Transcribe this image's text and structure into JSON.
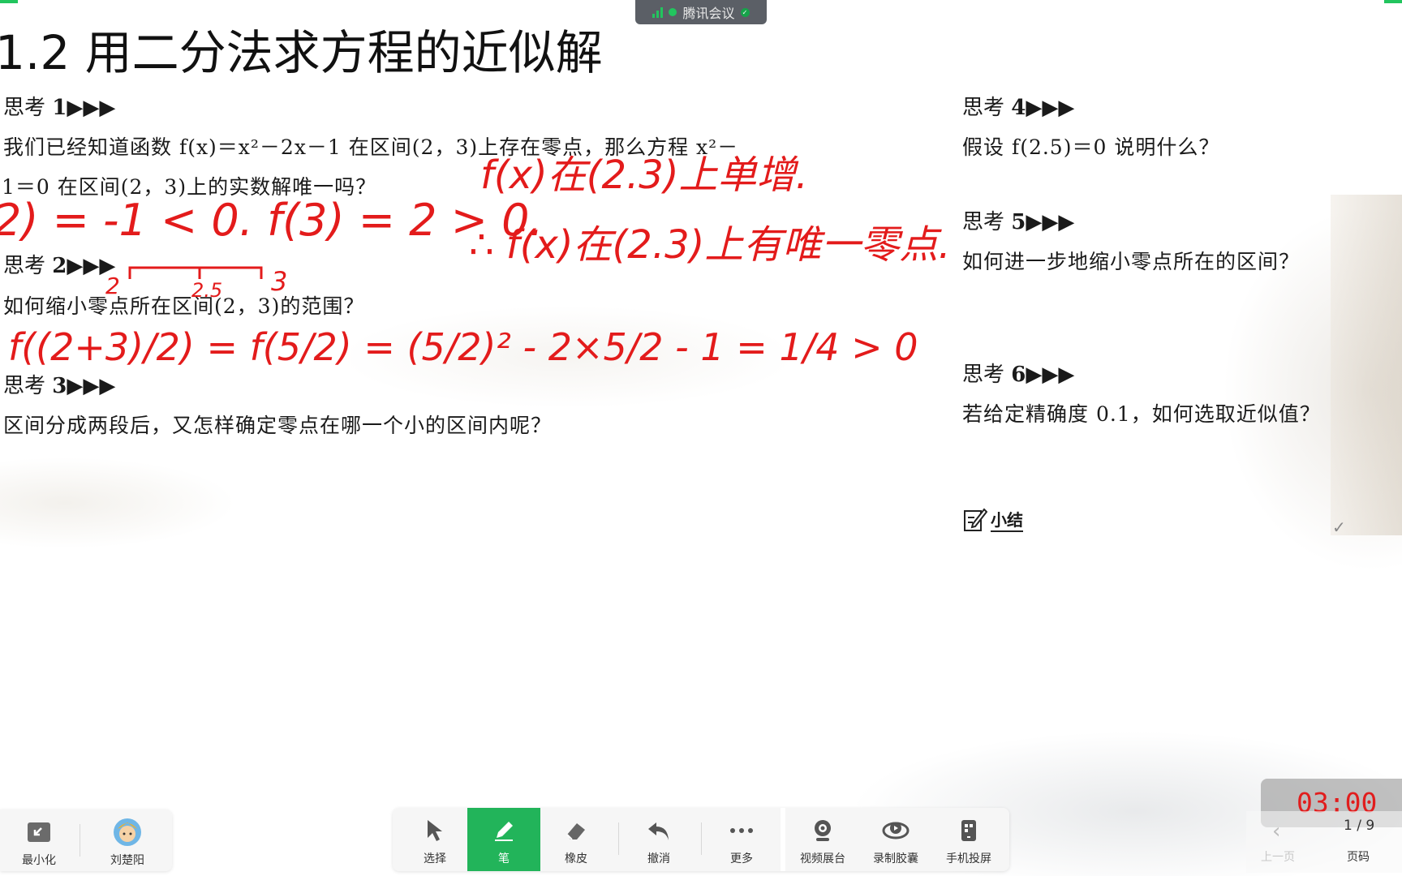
{
  "meeting_bar": {
    "label": "腾讯会议",
    "colors": {
      "bg": "#5b5f66",
      "signal": "#22c55e"
    }
  },
  "slide": {
    "title": "1.2 用二分法求方程的近似解",
    "left_column": [
      {
        "heading": "思考",
        "number": "1▶▶▶",
        "lines": [
          "我们已经知道函数 f(x)＝x²－2x－1 在区间(2，3)上存在零点，那么方程 x²－",
          "1＝0 在区间(2，3)上的实数解唯一吗？"
        ]
      },
      {
        "heading": "思考",
        "number": "2▶▶▶",
        "lines": [
          "如何缩小零点所在区间(2，3)的范围？"
        ]
      },
      {
        "heading": "思考",
        "number": "3▶▶▶",
        "lines": [
          "区间分成两段后，又怎样确定零点在哪一个小的区间内呢？"
        ]
      }
    ],
    "right_column": [
      {
        "heading": "思考",
        "number": "4▶▶▶",
        "lines": [
          "假设 f(2.5)＝0 说明什么？"
        ]
      },
      {
        "heading": "思考",
        "number": "5▶▶▶",
        "lines": [
          "如何进一步地缩小零点所在的区间？"
        ]
      },
      {
        "heading": "思考",
        "number": "6▶▶▶",
        "lines": [
          "若给定精确度 0.1，如何选取近似值？"
        ]
      }
    ],
    "summary_label": "小结",
    "summary_icon": "edit-note-icon"
  },
  "annotations": {
    "color": "#e31b1b",
    "line1": "f(x)在(2.3)上单增.",
    "line2": "∴ f(x)在(2.3)上有唯一零点.",
    "line3": "2) = -1 < 0.    f(3) = 2 > 0.",
    "numberline_labels": [
      "2",
      "2.5",
      "3"
    ],
    "line4": "f((2+3)/2) = f(5/2) = (5/2)² - 2×5/2 - 1 = 1/4 > 0"
  },
  "toolbar_left": [
    {
      "label": "最小化",
      "icon": "minimize-icon"
    },
    {
      "label": "刘楚阳",
      "icon": "avatar"
    }
  ],
  "toolbar_main": [
    {
      "label": "选择",
      "icon": "cursor-icon"
    },
    {
      "label": "笔",
      "icon": "pen-icon",
      "active": true
    },
    {
      "label": "橡皮",
      "icon": "eraser-icon"
    },
    {
      "label": "撤消",
      "icon": "undo-icon"
    },
    {
      "label": "更多",
      "icon": "more-icon"
    },
    {
      "label": "视频展台",
      "icon": "camera-icon"
    },
    {
      "label": "录制胶囊",
      "icon": "record-icon"
    },
    {
      "label": "手机投屏",
      "icon": "phone-cast-icon"
    }
  ],
  "timer": {
    "value": "03:00",
    "color": "#e11d1d"
  },
  "pager": {
    "current": "1 / 9",
    "prev_label": "上一页",
    "code_label": "页码"
  },
  "colors": {
    "accent": "#22b45a"
  }
}
